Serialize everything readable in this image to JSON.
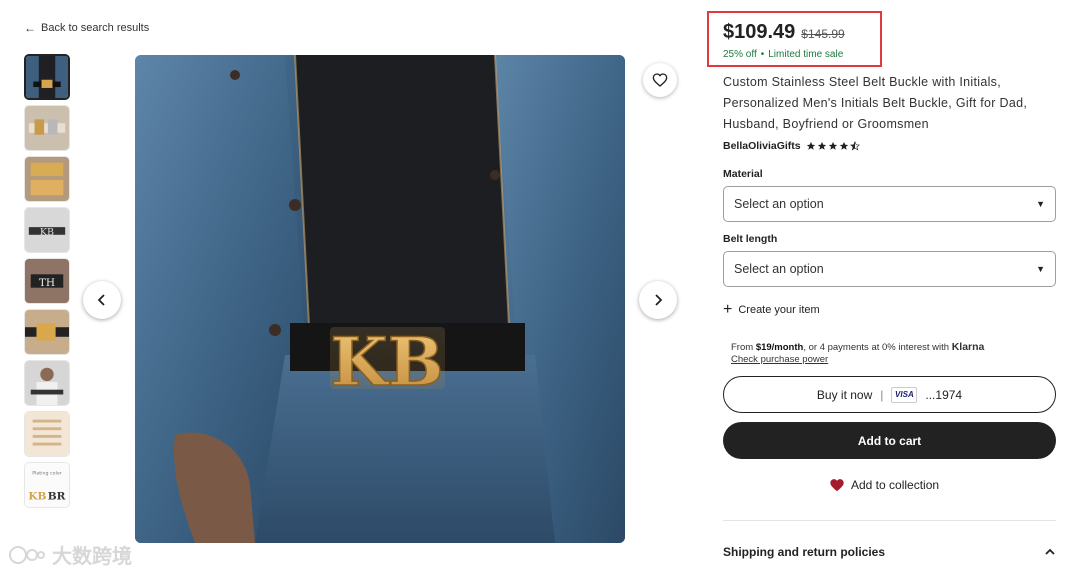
{
  "nav": {
    "back_label": "Back to search results"
  },
  "price": {
    "current": "$109.49",
    "original": "$145.99",
    "discount": "25% off",
    "bullet": "•",
    "sale_note": "Limited time sale"
  },
  "product": {
    "title": "Custom Stainless Steel Belt Buckle with Initials, Personalized Men's Initials Belt Buckle, Gift for Dad, Husband, Boyfriend or Groomsmen",
    "buckle_text": "KB"
  },
  "shop": {
    "name": "BellaOliviaGifts",
    "rating": 4.5
  },
  "options": {
    "material_label": "Material",
    "material_value": "Select an option",
    "length_label": "Belt length",
    "length_value": "Select an option"
  },
  "actions": {
    "create_item": "Create your item",
    "buy_now": "Buy it now",
    "card_brand": "VISA",
    "card_last4": "...1974",
    "add_to_cart": "Add to cart",
    "add_to_collection": "Add to collection"
  },
  "klarna": {
    "from": "From",
    "monthly": "$19/month",
    "rest": ", or 4 payments at 0% interest with",
    "brand": "Klarna",
    "link": "Check purchase power"
  },
  "policies": {
    "shipping_label": "Shipping and return policies"
  },
  "thumbnails": {
    "thumb4_text": "KB",
    "thumb5_text": "TH",
    "thumb9_caption": "Plating color",
    "thumb9_text_a": "KB",
    "thumb9_text_b": "BR"
  },
  "watermark": {
    "text": "大数跨境"
  },
  "colors": {
    "price_highlight": "#e0393e",
    "sale_green": "#1e7a3e",
    "dark_button": "#222222",
    "heart_red": "#a61a2e"
  }
}
